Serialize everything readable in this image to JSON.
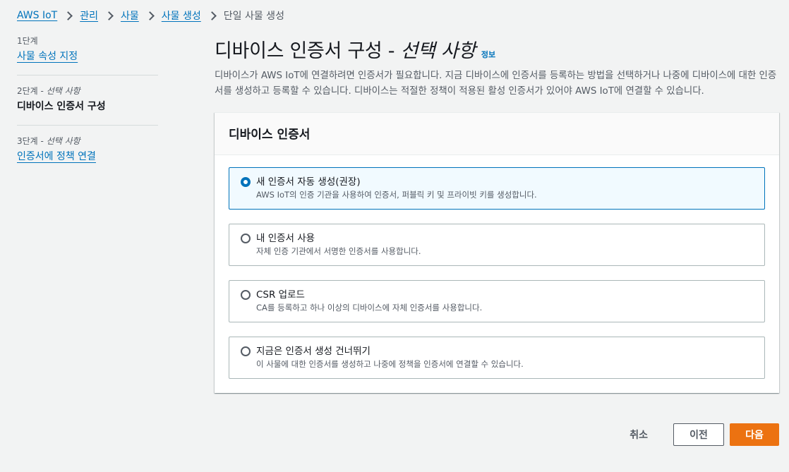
{
  "breadcrumb": {
    "items": [
      "AWS IoT",
      "관리",
      "사물",
      "사물 생성"
    ],
    "current": "단일 사물 생성"
  },
  "steps": [
    {
      "num": "1단계",
      "optional": "",
      "label": "사물 속성 지정"
    },
    {
      "num": "2단계",
      "optional": "선택 사항",
      "label": "디바이스 인증서 구성"
    },
    {
      "num": "3단계",
      "optional": "선택 사항",
      "label": "인증서에 정책 연결"
    }
  ],
  "page": {
    "title": "디바이스 인증서 구성 - ",
    "title_optional": "선택 사항",
    "info": "정보",
    "description": "디바이스가 AWS IoT에 연결하려면 인증서가 필요합니다. 지금 디바이스에 인증서를 등록하는 방법을 선택하거나 나중에 디바이스에 대한 인증서를 생성하고 등록할 수 있습니다. 디바이스는 적절한 정책이 적용된 활성 인증서가 있어야 AWS IoT에 연결할 수 있습니다."
  },
  "card": {
    "title": "디바이스 인증서",
    "options": [
      {
        "label": "새 인증서 자동 생성(권장)",
        "desc": "AWS IoT의 인증 기관을 사용하여 인증서, 퍼블릭 키 및 프라이빗 키를 생성합니다.",
        "selected": true
      },
      {
        "label": "내 인증서 사용",
        "desc": "자체 인증 기관에서 서명한 인증서를 사용합니다.",
        "selected": false
      },
      {
        "label": "CSR 업로드",
        "desc": "CA를 등록하고 하나 이상의 디바이스에 자체 인증서를 사용합니다.",
        "selected": false
      },
      {
        "label": "지금은 인증서 생성 건너뛰기",
        "desc": "이 사물에 대한 인증서를 생성하고 나중에 정책을 인증서에 연결할 수 있습니다.",
        "selected": false
      }
    ]
  },
  "footer": {
    "cancel": "취소",
    "previous": "이전",
    "next": "다음"
  },
  "colors": {
    "link": "#0073bb",
    "primary": "#ec7211",
    "selected_bg": "#f1faff"
  }
}
